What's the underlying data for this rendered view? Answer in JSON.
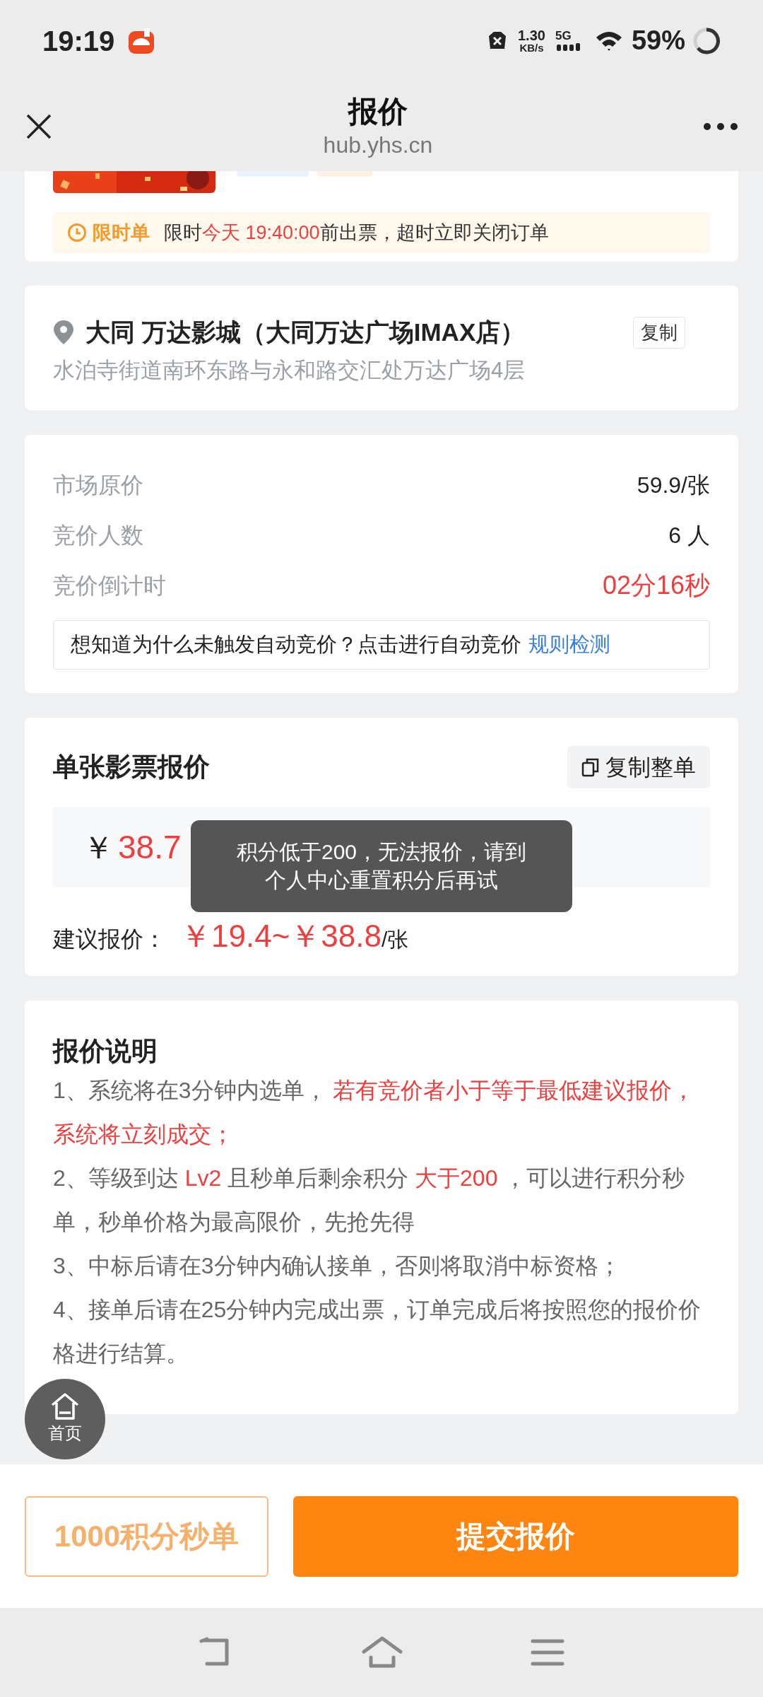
{
  "status_bar": {
    "time": "19:19",
    "network_speed": {
      "value": "1.30",
      "unit": "KB/s"
    },
    "network_type": "5G",
    "battery": "59%"
  },
  "header": {
    "title": "报价",
    "url": "hub.yhs.cn"
  },
  "order_card": {
    "deadline_notice": {
      "tag": "限时单",
      "segments": [
        {
          "text": "限时",
          "highlight": false
        },
        {
          "text": "今天 19:40:00",
          "highlight": true
        },
        {
          "text": "前出票，超时立即关闭订单",
          "highlight": false
        }
      ]
    }
  },
  "cinema": {
    "name": "大同 万达影城（大同万达广场IMAX店）",
    "address": "水泊寺街道南环东路与永和路交汇处万达广场4层",
    "copy_button": "复制"
  },
  "bid_info": {
    "rows": [
      {
        "label": "市场原价",
        "value": "59.9/张",
        "highlight": false
      },
      {
        "label": "竞价人数",
        "value": "6 人",
        "highlight": false
      },
      {
        "label": "竞价倒计时",
        "value": "02分16秒",
        "highlight": true
      }
    ],
    "tip": {
      "text": "想知道为什么未触发自动竞价？点击进行自动竞价",
      "link": "规则检测"
    }
  },
  "quote": {
    "title": "单张影票报价",
    "copy_all_button": "复制整单",
    "currency": "￥",
    "price": "38.7",
    "suggested_label": "建议报价：",
    "suggested_range": "￥19.4~￥38.8",
    "suggested_unit": "/张"
  },
  "toast": {
    "text": "积分低于200，无法报价，请到个人中心重置积分后再试"
  },
  "explanation": {
    "title": "报价说明",
    "items": [
      [
        {
          "text": "1、系统将在3分钟内选单，",
          "highlight": false
        },
        {
          "text": " 若有竞价者小于等于最低建议报价，系统将立刻成交；",
          "highlight": true
        }
      ],
      [
        {
          "text": "2、等级到达 ",
          "highlight": false
        },
        {
          "text": "Lv2",
          "highlight": true
        },
        {
          "text": " 且秒单后剩余积分 ",
          "highlight": false
        },
        {
          "text": "大于200",
          "highlight": true
        },
        {
          "text": " ，可以进行积分秒单，秒单价格为最高限价，先抢先得",
          "highlight": false
        }
      ],
      [
        {
          "text": "3、中标后请在3分钟内确认接单，否则将取消中标资格；",
          "highlight": false
        }
      ],
      [
        {
          "text": "4、接单后请在25分钟内完成出票，订单完成后将按照您的报价价格进行结算。",
          "highlight": false
        }
      ]
    ]
  },
  "floating_home": {
    "label": "首页"
  },
  "actions": {
    "points_button": "1000积分秒单",
    "submit_button": "提交报价"
  }
}
